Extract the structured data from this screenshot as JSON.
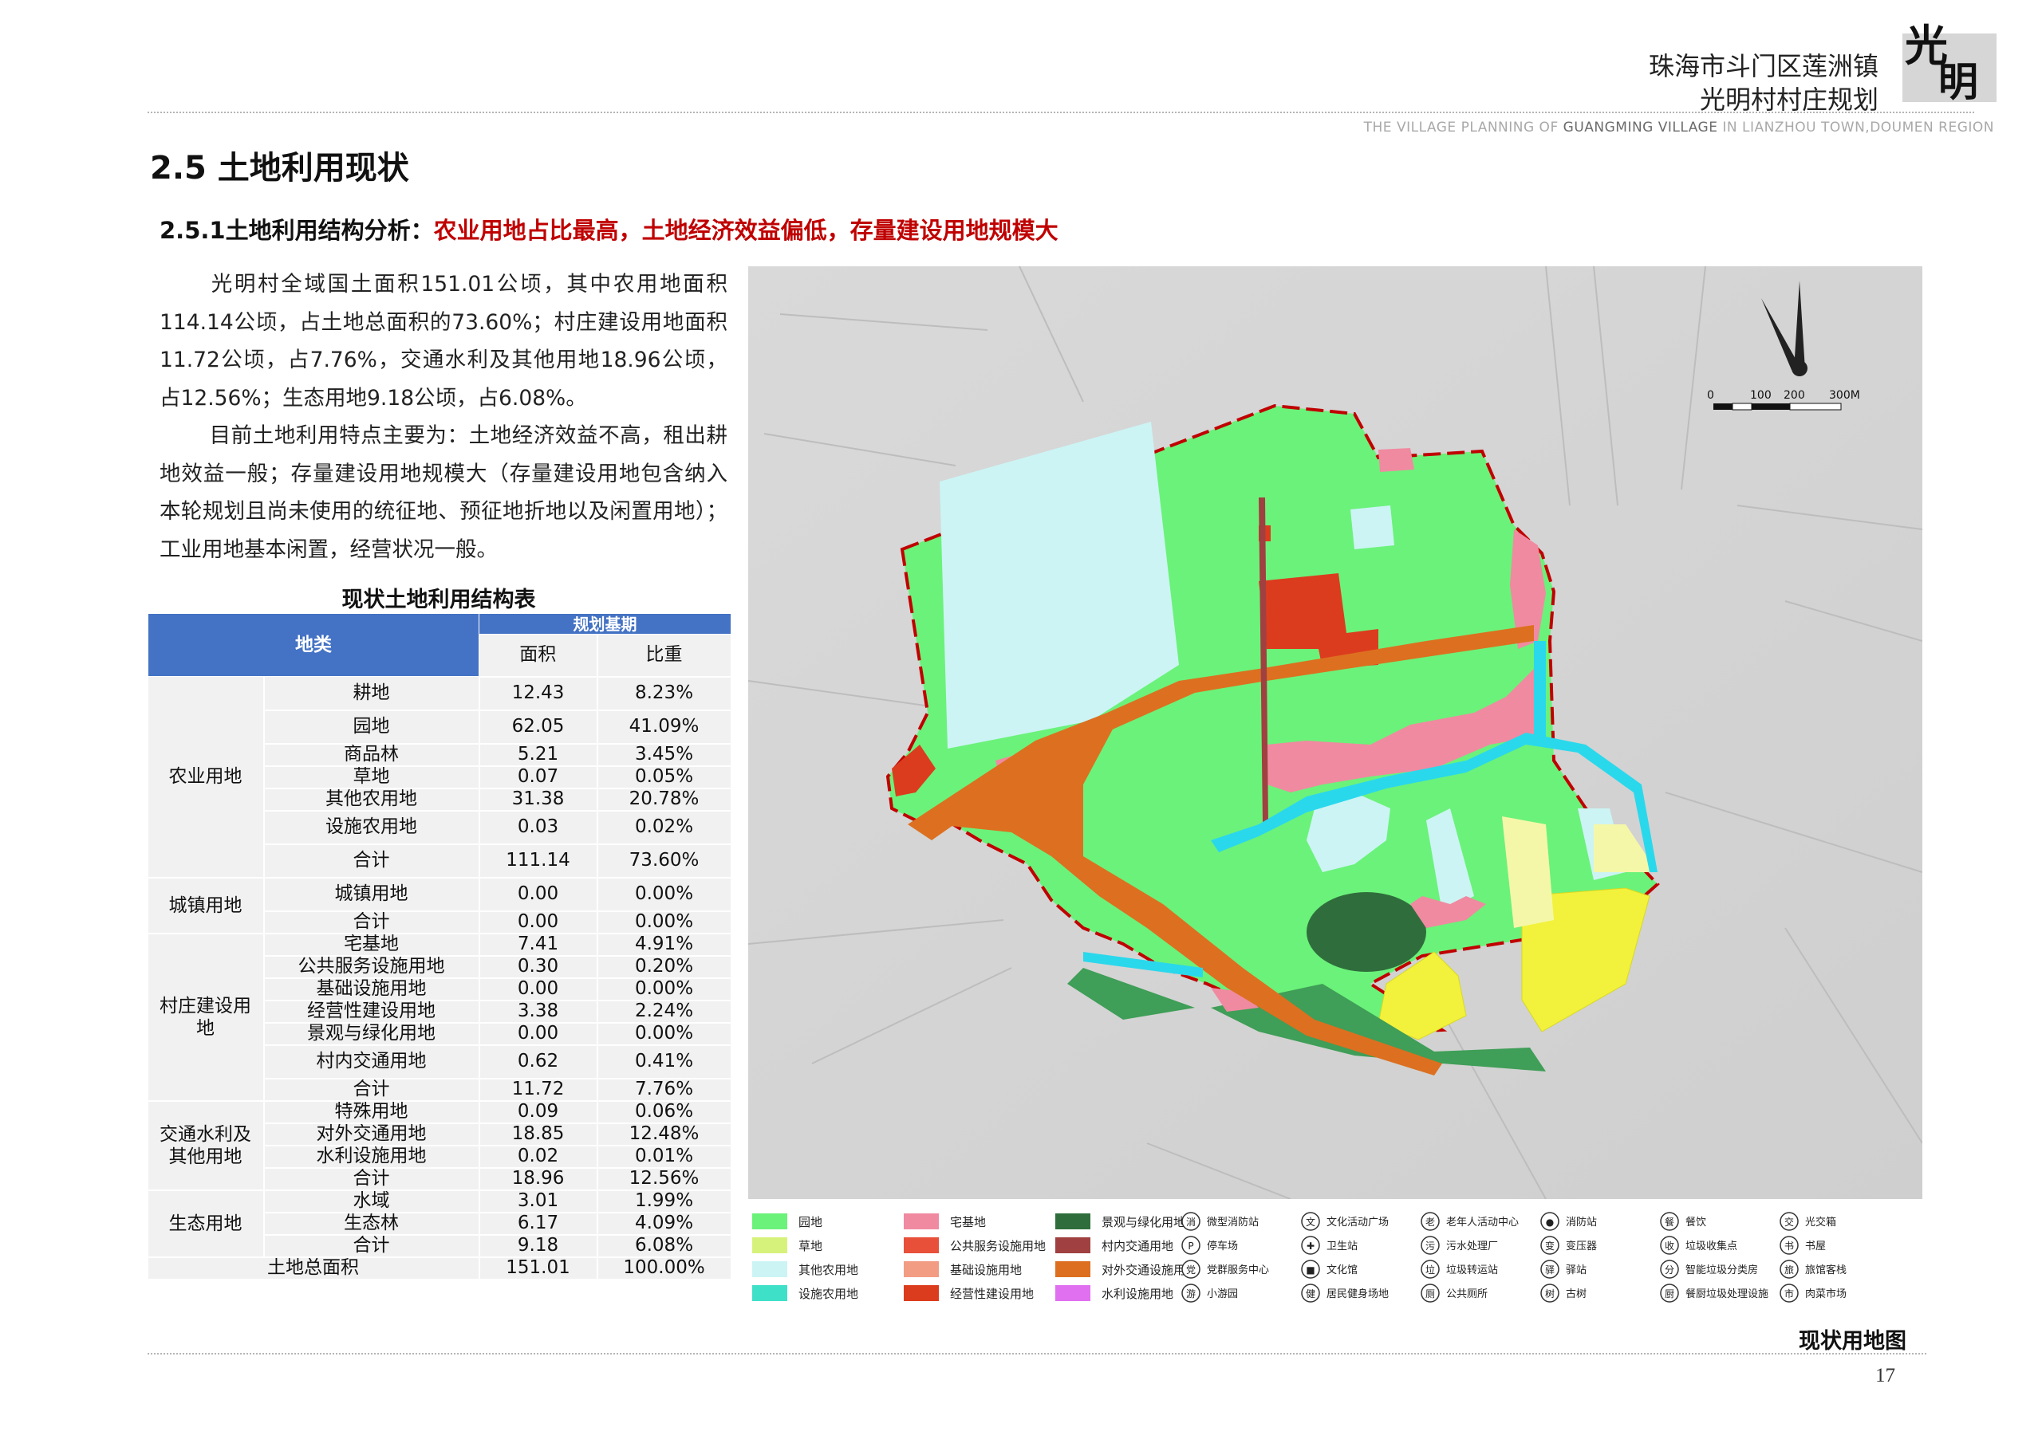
{
  "header": {
    "line1": "珠海市斗门区莲洲镇",
    "line2": "光明村村庄规划",
    "logo_text": "光明",
    "en_pre": "THE VILLAGE PLANNING OF",
    "en_bold": "GUANGMING VILLAGE",
    "en_post": "IN LIANZHOU TOWN,DOUMEN REGION"
  },
  "section_title": "2.5 土地利用现状",
  "subsection": {
    "label": "2.5.1土地利用结构分析：",
    "highlight": "农业用地占比最高，土地经济效益偏低，存量建设用地规模大"
  },
  "paragraphs": [
    "光明村全域国土面积151.01公顷，其中农用地面积114.14公顷，占土地总面积的73.60%；村庄建设用地面积11.72公顷，占7.76%，交通水利及其他用地18.96公顷，占12.56%；生态用地9.18公顷，占6.08%。",
    "目前土地利用特点主要为：土地经济效益不高，租出耕地效益一般；存量建设用地规模大（存量建设用地包含纳入本轮规划且尚未使用的统征地、预征地折地以及闲置用地）；工业用地基本闲置，经营状况一般。"
  ],
  "table": {
    "title": "现状土地利用结构表",
    "header_category": "地类",
    "header_period": "规划基期",
    "header_area": "面积",
    "header_ratio": "比重",
    "groups": [
      {
        "name": "农业用地",
        "rows": [
          {
            "item": "耕地",
            "area": "12.43",
            "ratio": "8.23%"
          },
          {
            "item": "园地",
            "area": "62.05",
            "ratio": "41.09%"
          },
          {
            "item": "商品林",
            "area": "5.21",
            "ratio": "3.45%"
          },
          {
            "item": "草地",
            "area": "0.07",
            "ratio": "0.05%"
          },
          {
            "item": "其他农用地",
            "area": "31.38",
            "ratio": "20.78%"
          },
          {
            "item": "设施农用地",
            "area": "0.03",
            "ratio": "0.02%"
          },
          {
            "item": "合计",
            "area": "111.14",
            "ratio": "73.60%"
          }
        ]
      },
      {
        "name": "城镇用地",
        "rows": [
          {
            "item": "城镇用地",
            "area": "0.00",
            "ratio": "0.00%"
          },
          {
            "item": "合计",
            "area": "0.00",
            "ratio": "0.00%"
          }
        ]
      },
      {
        "name": "村庄建设用地",
        "rows": [
          {
            "item": "宅基地",
            "area": "7.41",
            "ratio": "4.91%"
          },
          {
            "item": "公共服务设施用地",
            "area": "0.30",
            "ratio": "0.20%"
          },
          {
            "item": "基础设施用地",
            "area": "0.00",
            "ratio": "0.00%"
          },
          {
            "item": "经营性建设用地",
            "area": "3.38",
            "ratio": "2.24%"
          },
          {
            "item": "景观与绿化用地",
            "area": "0.00",
            "ratio": "0.00%"
          },
          {
            "item": "村内交通用地",
            "area": "0.62",
            "ratio": "0.41%"
          },
          {
            "item": "合计",
            "area": "11.72",
            "ratio": "7.76%"
          }
        ]
      },
      {
        "name": "交通水利及其他用地",
        "rows": [
          {
            "item": "特殊用地",
            "area": "0.09",
            "ratio": "0.06%"
          },
          {
            "item": "对外交通用地",
            "area": "18.85",
            "ratio": "12.48%"
          },
          {
            "item": "水利设施用地",
            "area": "0.02",
            "ratio": "0.01%"
          },
          {
            "item": "合计",
            "area": "18.96",
            "ratio": "12.56%"
          }
        ]
      },
      {
        "name": "生态用地",
        "rows": [
          {
            "item": "水域",
            "area": "3.01",
            "ratio": "1.99%"
          },
          {
            "item": "生态林",
            "area": "6.17",
            "ratio": "4.09%"
          },
          {
            "item": "合计",
            "area": "9.18",
            "ratio": "6.08%"
          }
        ]
      }
    ],
    "total": {
      "item": "土地总面积",
      "area": "151.01",
      "ratio": "100.00%"
    }
  },
  "map": {
    "caption": "现状用地图",
    "scale_labels": [
      "0",
      "100",
      "200",
      "300M"
    ],
    "colors": {
      "garden": "#6bf27a",
      "grass": "#d7f27a",
      "other_agri": "#ccf4f4",
      "facility_agri": "#3fe0c8",
      "homestead": "#f08aa0",
      "public_service": "#e8503a",
      "infrastructure": "#f29c84",
      "commercial": "#dc3c1e",
      "landscape_green": "#2f6e3c",
      "village_traffic": "#a04040",
      "external_traffic": "#dc7020",
      "water_facility": "#e070f0",
      "arable": "#f2f23c",
      "forest": "#3f9e57",
      "water": "#2ad8ec",
      "boundary": "#c00000"
    },
    "legend": [
      {
        "label": "园地",
        "color": "#6bf27a"
      },
      {
        "label": "草地",
        "color": "#d7f27a"
      },
      {
        "label": "其他农用地",
        "color": "#ccf4f4"
      },
      {
        "label": "设施农用地",
        "color": "#3fe0c8"
      },
      {
        "label": "宅基地",
        "color": "#f08aa0"
      },
      {
        "label": "公共服务设施用地",
        "color": "#e8503a"
      },
      {
        "label": "基础设施用地",
        "color": "#f29c84"
      },
      {
        "label": "经营性建设用地",
        "color": "#dc3c1e"
      },
      {
        "label": "景观与绿化用地",
        "color": "#2f6e3c"
      },
      {
        "label": "村内交通用地",
        "color": "#a04040"
      },
      {
        "label": "对外交通设施用地",
        "color": "#dc7020"
      },
      {
        "label": "水利设施用地",
        "color": "#e070f0"
      }
    ],
    "symbols": [
      {
        "sym": "消",
        "label": "微型消防站"
      },
      {
        "sym": "P",
        "label": "停车场"
      },
      {
        "sym": "党",
        "label": "党群服务中心"
      },
      {
        "sym": "游",
        "label": "小游园"
      },
      {
        "sym": "文",
        "label": "文化活动广场"
      },
      {
        "sym": "✚",
        "label": "卫生站"
      },
      {
        "sym": "■",
        "label": "文化馆"
      },
      {
        "sym": "健",
        "label": "居民健身场地"
      },
      {
        "sym": "老",
        "label": "老年人活动中心"
      },
      {
        "sym": "污",
        "label": "污水处理厂"
      },
      {
        "sym": "垃",
        "label": "垃圾转运站"
      },
      {
        "sym": "厕",
        "label": "公共厕所"
      },
      {
        "sym": "●",
        "label": "消防站"
      },
      {
        "sym": "变",
        "label": "变压器"
      },
      {
        "sym": "驿",
        "label": "驿站"
      },
      {
        "sym": "树",
        "label": "古树"
      },
      {
        "sym": "餐",
        "label": "餐饮"
      },
      {
        "sym": "收",
        "label": "垃圾收集点"
      },
      {
        "sym": "分",
        "label": "智能垃圾分类房"
      },
      {
        "sym": "厨",
        "label": "餐厨垃圾处理设施"
      },
      {
        "sym": "交",
        "label": "光交箱"
      },
      {
        "sym": "书",
        "label": "书屋"
      },
      {
        "sym": "旅",
        "label": "旅馆客栈"
      },
      {
        "sym": "市",
        "label": "肉菜市场"
      }
    ]
  },
  "page_number": "17"
}
